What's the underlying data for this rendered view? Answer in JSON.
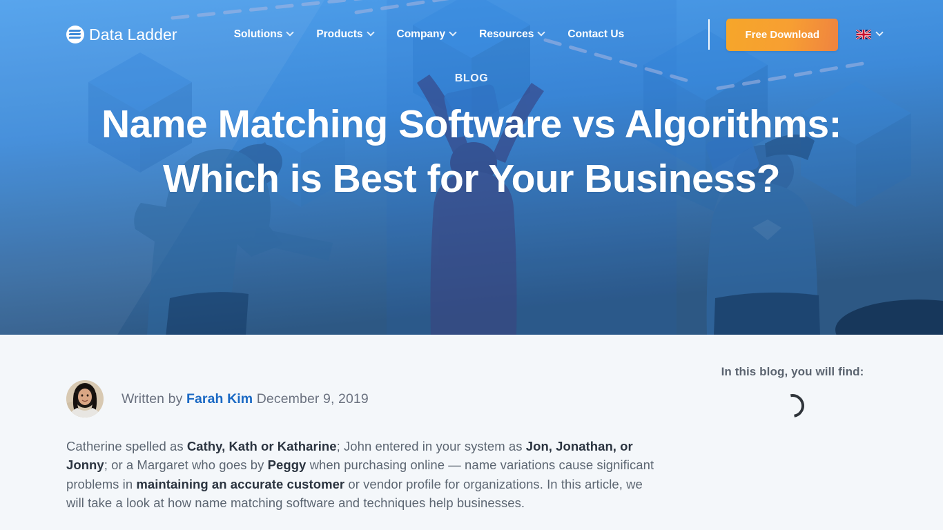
{
  "brand": {
    "name": "Data Ladder",
    "logo_icon": "data-ladder-logo-icon"
  },
  "nav": {
    "items": [
      {
        "label": "Solutions",
        "has_dropdown": true
      },
      {
        "label": "Products",
        "has_dropdown": true
      },
      {
        "label": "Company",
        "has_dropdown": true
      },
      {
        "label": "Resources",
        "has_dropdown": true
      },
      {
        "label": "Contact Us",
        "has_dropdown": false
      }
    ],
    "cta_label": "Free Download",
    "cta_color": "#f5a02c",
    "language": {
      "flag_icon": "uk-flag-icon",
      "chevron_icon": "chevron-down-icon"
    }
  },
  "hero": {
    "eyebrow": "BLOG",
    "title": "Name Matching Software vs Algorithms: Which is Best for Your Business?",
    "background_gradient_from": "#4a9ae8",
    "background_gradient_to": "#2f5d8c"
  },
  "article": {
    "byline": {
      "prefix": "Written by",
      "author": "Farah Kim",
      "date": "December 9, 2019",
      "author_color": "#1a69c4",
      "avatar_icon": "author-avatar"
    },
    "paragraph": {
      "p1": "Catherine spelled as ",
      "b1": "Cathy, Kath or Katharine",
      "p2": "; John entered in your system as ",
      "b2": "Jon, Jonathan, or Jonny",
      "p3": "; or a Margaret who goes by ",
      "b3": "Peggy",
      "p4": " when purchasing online — name variations cause significant problems in ",
      "b4": "maintaining an accurate customer",
      "p5": " or vendor profile for organizations. In this article, we will take a look at how name matching software and techniques help businesses."
    }
  },
  "sidebar": {
    "title": "In this blog, you will find:",
    "loading_icon": "loading-spinner-icon"
  }
}
